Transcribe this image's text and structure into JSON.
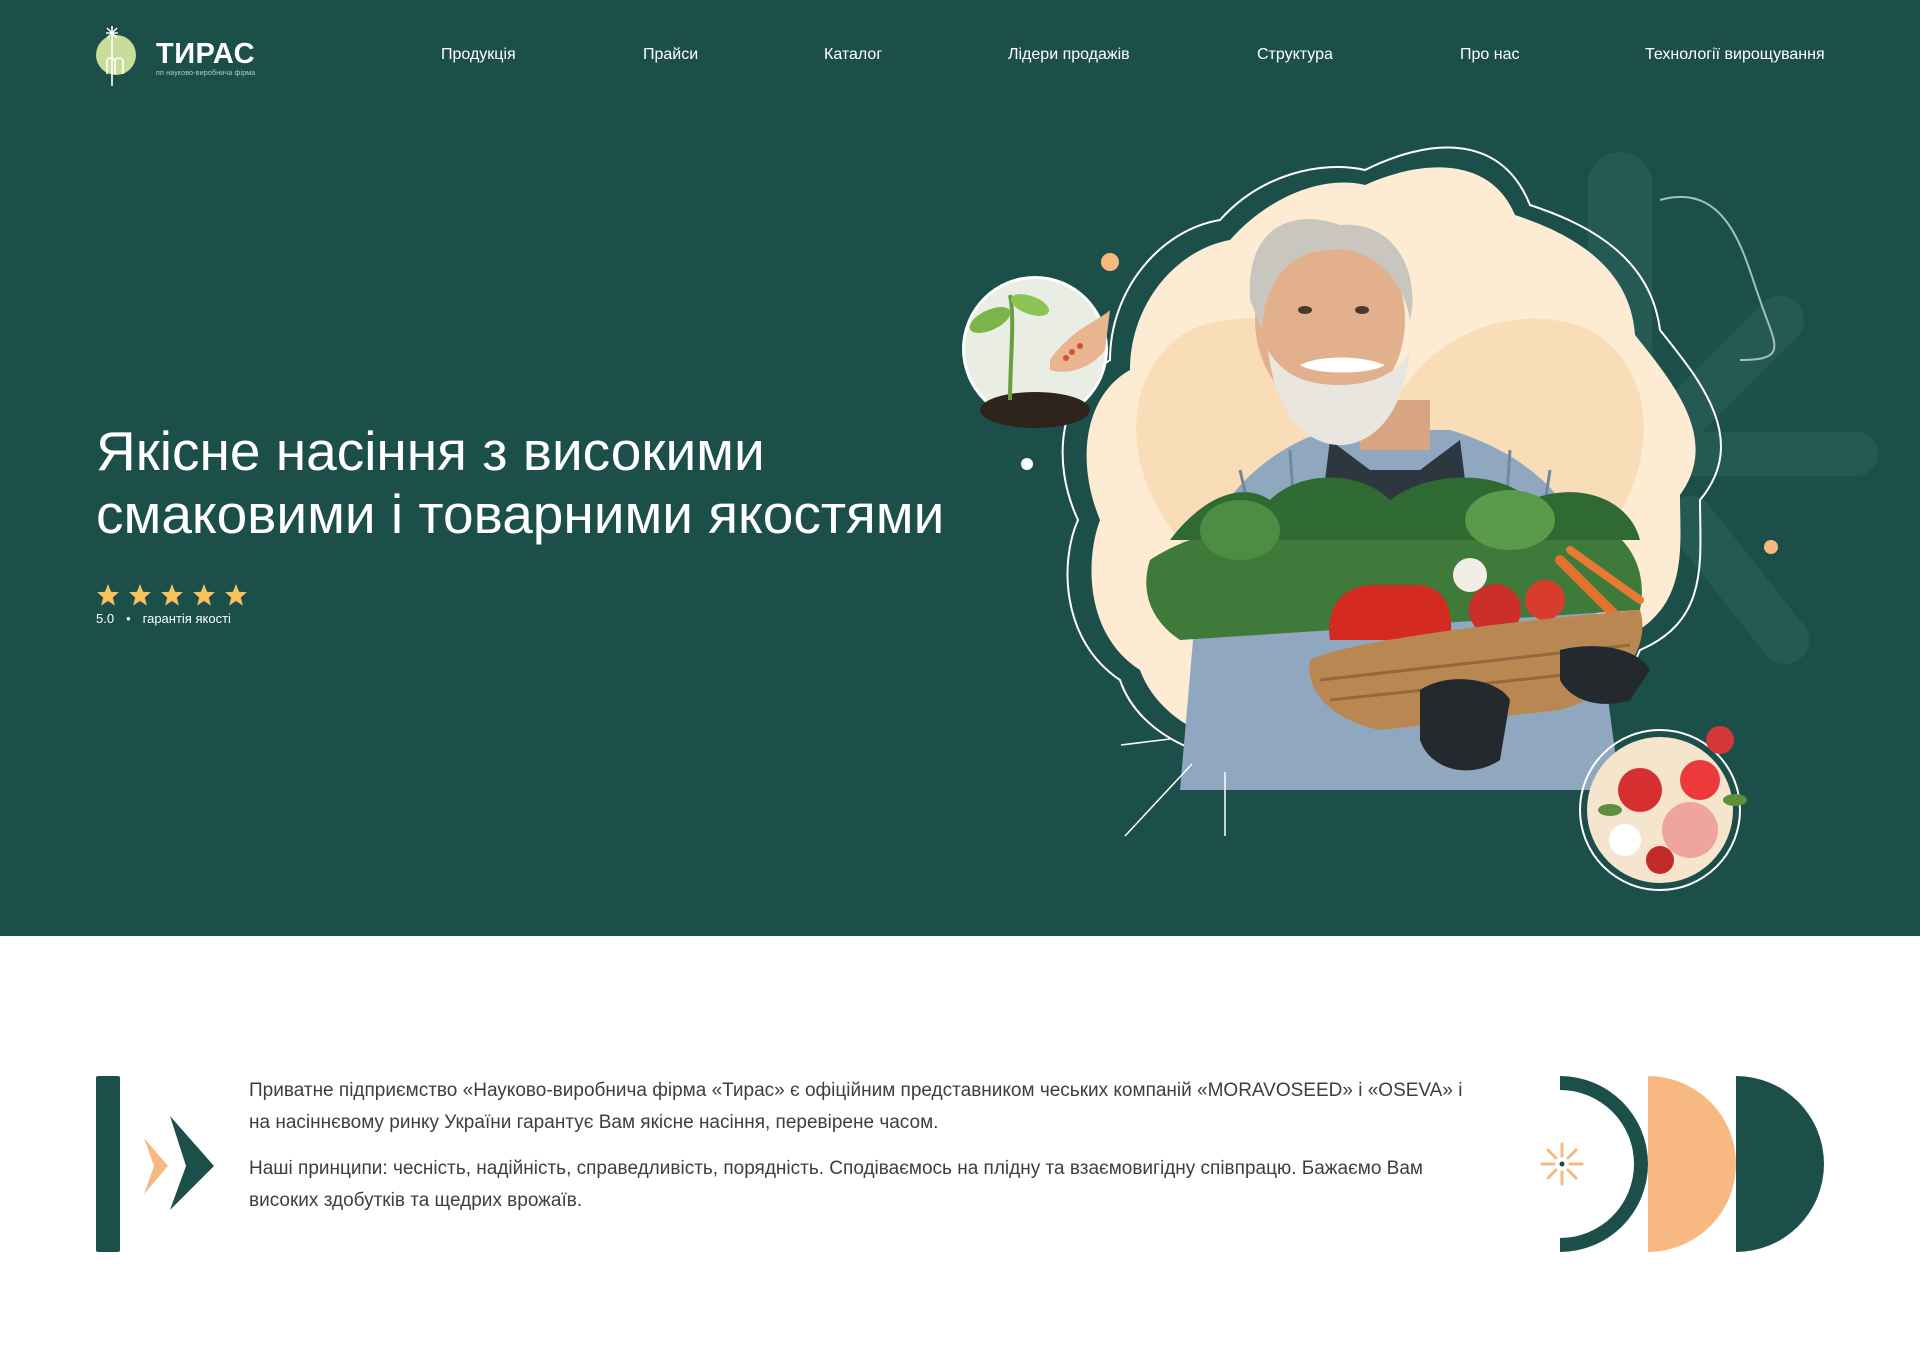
{
  "brand": {
    "name": "ТИРАС",
    "tagline": "пп науково-виробнича фірма"
  },
  "nav": {
    "items": [
      {
        "label": "Продукція"
      },
      {
        "label": "Прайси"
      },
      {
        "label": "Каталог"
      },
      {
        "label": "Лідери продажів"
      },
      {
        "label": "Структура"
      },
      {
        "label": "Про нас"
      },
      {
        "label": "Технології вирощування"
      }
    ]
  },
  "hero": {
    "title_line1": "Якісне насіння з високими",
    "title_line2": "смаковими і товарними якостями",
    "rating": {
      "stars": 5,
      "value": "5.0",
      "separator": "•",
      "label": "гарантія якості"
    }
  },
  "about": {
    "paragraph1": "Приватне підприємство «Науково-виробнича фірма «Тирас» є офіційним представником чеських компаній «MORAVOSEED» і «OSEVA» і на насіннєвому ринку України гарантує Вам якісне насіння, перевірене часом.",
    "paragraph2": "Наші принципи: чесність, надійність, справедливість, порядність. Сподіваємось на плідну та взаємовигідну співпрацю. Бажаємо Вам високих здобутків та щедрих врожаїв."
  },
  "colors": {
    "primary": "#1d4f4a",
    "accent_peach": "#f7b882",
    "light_green": "#c9dd9a",
    "star": "#f5c35a",
    "text": "#3a3f44"
  },
  "icons": {
    "logo": "sprout-logo-icon",
    "star": "star-icon",
    "chevrons": "double-chevron-icon",
    "sunburst": "sunburst-icon"
  }
}
